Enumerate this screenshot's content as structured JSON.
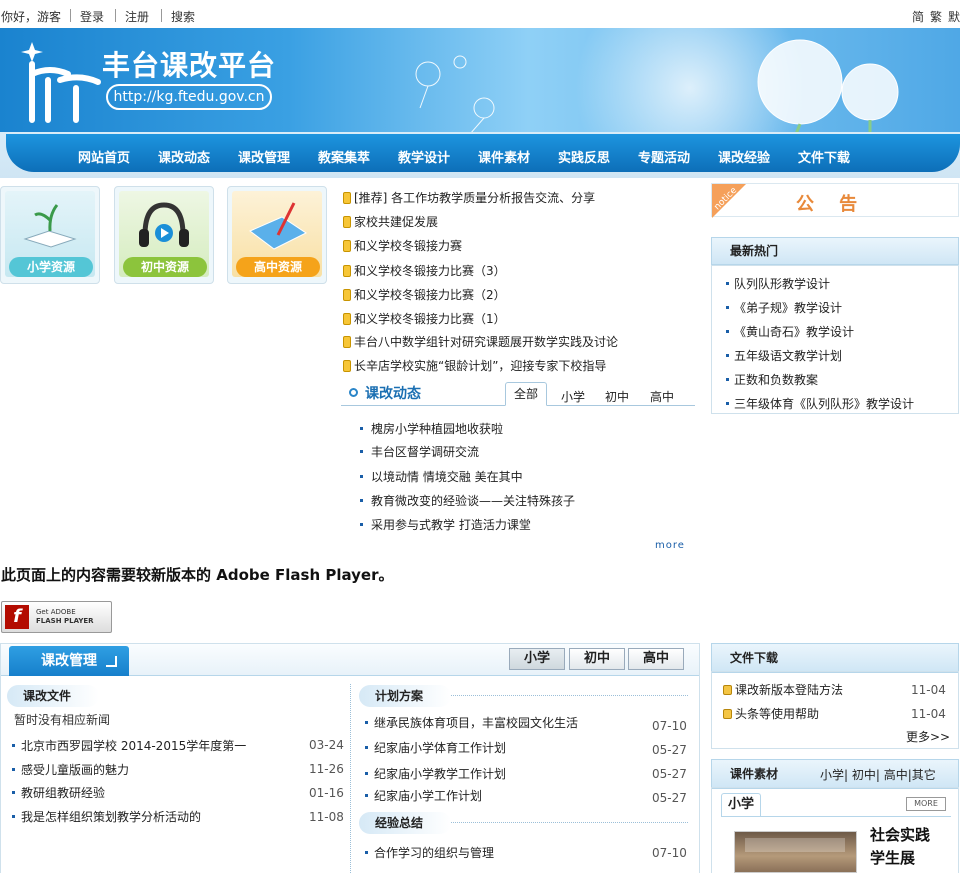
{
  "topbar": {
    "greeting": "你好，游客",
    "login": "登录",
    "register": "注册",
    "search": "搜索",
    "lang_simplified": "简",
    "lang_traditional": "繁",
    "lang_default": "默"
  },
  "banner": {
    "title": "丰台课改平台",
    "url": "http://kg.ftedu.gov.cn"
  },
  "nav": [
    "网站首页",
    "课改动态",
    "课改管理",
    "教案集萃",
    "教学设计",
    "课件素材",
    "实践反思",
    "专题活动",
    "课改经验",
    "文件下载"
  ],
  "resources": [
    {
      "label": "小学资源",
      "color": "#54c6d6"
    },
    {
      "label": "初中资源",
      "color": "#8cc43c"
    },
    {
      "label": "高中资源",
      "color": "#f5a31a"
    }
  ],
  "headlines": [
    "[推荐] 各工作坊教学质量分析报告交流、分享",
    "家校共建促发展",
    "和义学校冬锻接力赛",
    "和义学校冬锻接力比赛（3）",
    "和义学校冬锻接力比赛（2）",
    "和义学校冬锻接力比赛（1）",
    "丰台八中数学组针对研究课题展开数学实践及讨论",
    "长辛店学校实施“银龄计划”，迎接专家下校指导"
  ],
  "dynamics": {
    "title": "课改动态",
    "tabs": [
      "全部",
      "小学",
      "初中",
      "高中"
    ],
    "active_tab": "全部",
    "items": [
      "槐房小学种植园地收获啦",
      "丰台区督学调研交流",
      "以境动情 情境交融 美在其中",
      "教育微改变的经验谈——关注特殊孩子",
      "采用参与式教学 打造活力课堂"
    ],
    "more": "more"
  },
  "notice": {
    "tag": "notice",
    "title": "公    告"
  },
  "hot": {
    "title": "最新热门",
    "items": [
      "队列队形教学设计",
      "《弟子规》教学设计",
      "《黄山奇石》教学设计",
      "五年级语文教学计划",
      "正数和负数教案",
      "三年级体育《队列队形》教学设计"
    ]
  },
  "flash": {
    "message": "此页面上的内容需要较新版本的 Adobe Flash Player。",
    "badge_line1": "Get ADOBE",
    "badge_line2": "FLASH PLAYER"
  },
  "management": {
    "title": "课改管理",
    "tabs": [
      "小学",
      "初中",
      "高中"
    ],
    "active_tab": "小学",
    "files": {
      "title": "课改文件",
      "empty": "暂时没有相应新闻",
      "items": [
        {
          "text": "北京市西罗园学校 2014-2015学年度第一",
          "date": "03-24"
        },
        {
          "text": "感受儿童版画的魅力",
          "date": "11-26"
        },
        {
          "text": "教研组教研经验",
          "date": "01-16"
        },
        {
          "text": "我是怎样组织策划教学分析活动的",
          "date": "11-08"
        }
      ]
    },
    "plans": {
      "title": "计划方案",
      "items": [
        {
          "text": "继承民族体育项目，丰富校园文化生活",
          "date": "07-10"
        },
        {
          "text": "纪家庙小学体育工作计划",
          "date": "05-27"
        },
        {
          "text": "纪家庙小学教学工作计划",
          "date": "05-27"
        },
        {
          "text": "纪家庙小学工作计划",
          "date": "05-27"
        }
      ]
    },
    "experience": {
      "title": "经验总结",
      "items": [
        {
          "text": "合作学习的组织与管理",
          "date": "07-10"
        }
      ]
    }
  },
  "downloads": {
    "title": "文件下载",
    "items": [
      {
        "text": "课改新版本登陆方法",
        "date": "11-04"
      },
      {
        "text": "头条等使用帮助",
        "date": "11-04"
      }
    ],
    "more": "更多>>"
  },
  "courseware": {
    "title": "课件素材",
    "links": "小学| 初中| 高中|其它",
    "tab": "小学",
    "more": "MORE",
    "caption_line1": "社会实践",
    "caption_line2": "学生展"
  }
}
